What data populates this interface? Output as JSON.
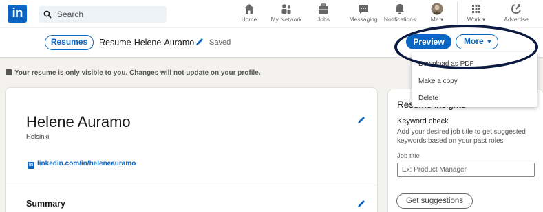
{
  "nav": {
    "logo_text": "in",
    "search_placeholder": "Search",
    "items": [
      {
        "label": "Home",
        "icon": "home-icon"
      },
      {
        "label": "My Network",
        "icon": "network-icon"
      },
      {
        "label": "Jobs",
        "icon": "briefcase-icon"
      },
      {
        "label": "Messaging",
        "icon": "messaging-icon"
      },
      {
        "label": "Notifications",
        "icon": "bell-icon"
      },
      {
        "label": "Me",
        "icon": "avatar-icon"
      },
      {
        "label": "Work",
        "icon": "grid-icon"
      },
      {
        "label": "Advertise",
        "icon": "advertise-icon"
      }
    ]
  },
  "subheader": {
    "resumes_label": "Resumes",
    "resume_name": "Resume-Helene-Auramo",
    "saved_label": "Saved",
    "preview_label": "Preview",
    "more_label": "More"
  },
  "notice": "Your resume is only visible to you. Changes will not update on your profile.",
  "dropdown": {
    "items": [
      "Download as PDF",
      "Make a copy",
      "Delete"
    ]
  },
  "profile": {
    "name": "Helene Auramo",
    "city": "Helsinki",
    "linkedin_url": "linkedin.com/in/heleneauramo",
    "summary_heading": "Summary"
  },
  "insights": {
    "title": "Resume insights",
    "keyword_heading": "Keyword check",
    "keyword_desc": "Add your desired job title to get suggested keywords based on your past roles",
    "job_title_label": "Job title",
    "job_title_placeholder": "Ex: Product Manager",
    "button_label": "Get suggestions"
  },
  "colors": {
    "brand": "#0a66c2",
    "annotation": "#0d1a40"
  }
}
